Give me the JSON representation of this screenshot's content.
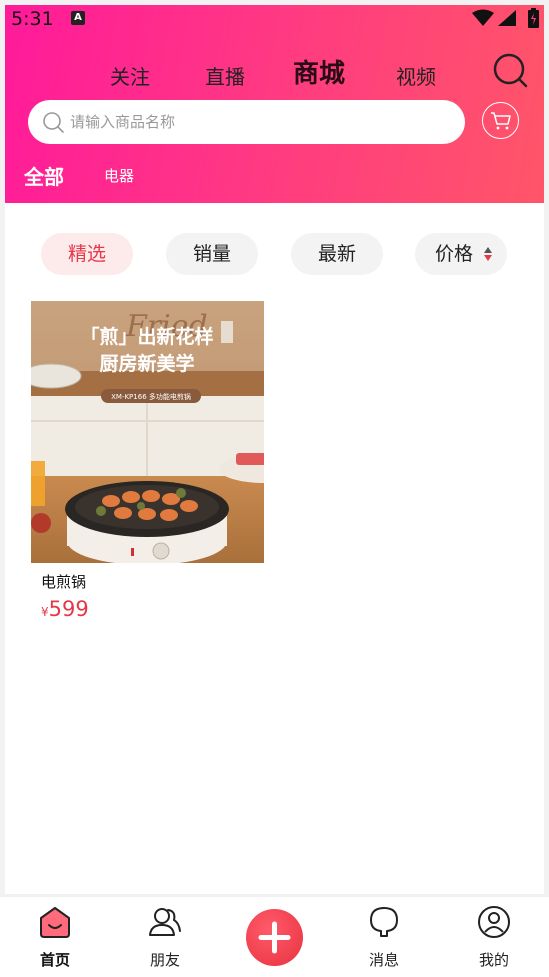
{
  "status_bar": {
    "time": "5:31",
    "notification_glyph": "A"
  },
  "top_tabs": [
    {
      "label": "关注",
      "active": false
    },
    {
      "label": "直播",
      "active": false
    },
    {
      "label": "商城",
      "active": true
    },
    {
      "label": "视频",
      "active": false
    }
  ],
  "search": {
    "placeholder": "请输入商品名称",
    "value": ""
  },
  "categories": [
    {
      "label": "全部",
      "active": true
    },
    {
      "label": "电器",
      "active": false
    }
  ],
  "filters": [
    {
      "label": "精选",
      "active": true
    },
    {
      "label": "销量",
      "active": false
    },
    {
      "label": "最新",
      "active": false
    },
    {
      "label": "价格",
      "active": false
    }
  ],
  "products": [
    {
      "name": "电煎锅",
      "currency": "¥",
      "price": "599",
      "image_text": {
        "script": "Fried",
        "line1": "「煎」出新花样",
        "line2": "厨房新美学",
        "model": "XM-KP166 多功能电煎锅"
      }
    }
  ],
  "bottom_nav": [
    {
      "label": "首页",
      "icon": "home-icon",
      "active": true
    },
    {
      "label": "朋友",
      "icon": "friends-icon",
      "active": false
    },
    {
      "label": "",
      "icon": "plus-icon",
      "active": false
    },
    {
      "label": "消息",
      "icon": "message-icon",
      "active": false
    },
    {
      "label": "我的",
      "icon": "profile-icon",
      "active": false
    }
  ],
  "colors": {
    "accent": "#e5394a",
    "header_start": "#ff1a9a",
    "header_end": "#ff5568"
  }
}
